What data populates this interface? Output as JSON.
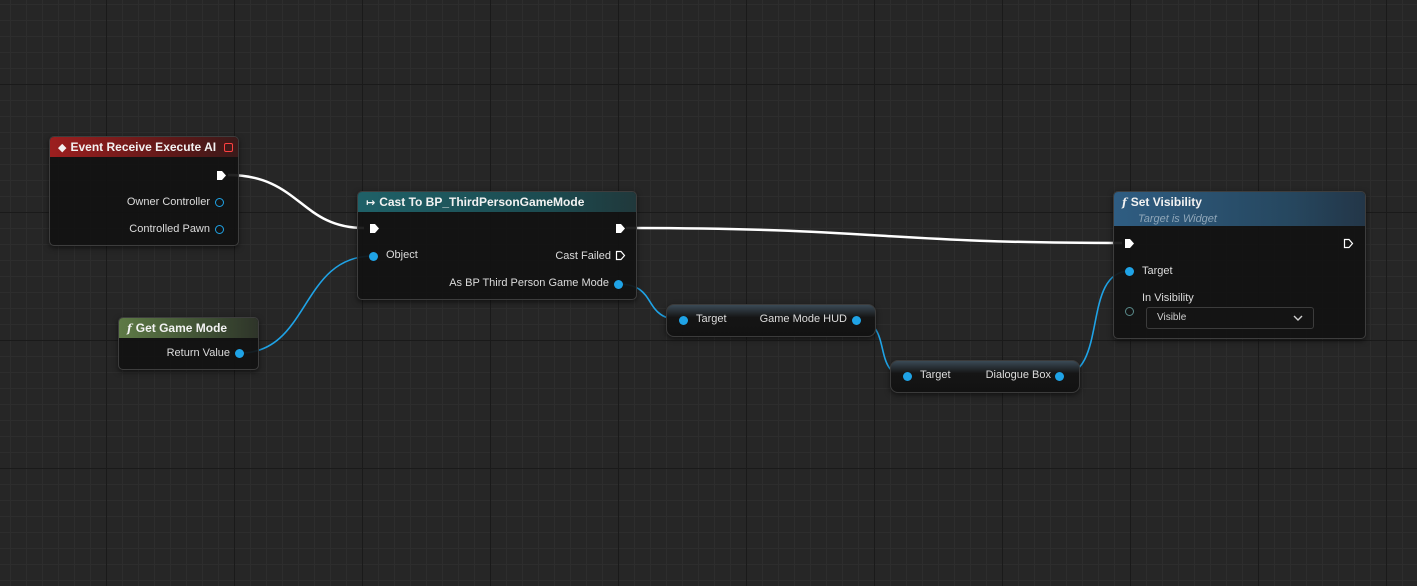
{
  "nodes": {
    "event": {
      "title": "Event Receive Execute AI",
      "pins": {
        "owner_controller": "Owner Controller",
        "controlled_pawn": "Controlled Pawn"
      }
    },
    "get_game_mode": {
      "title": "Get Game Mode",
      "pins": {
        "return_value": "Return Value"
      }
    },
    "cast": {
      "title": "Cast To BP_ThirdPersonGameMode",
      "pins": {
        "object": "Object",
        "cast_failed": "Cast Failed",
        "as_bp": "As BP Third Person Game Mode"
      }
    },
    "get_hud": {
      "pins": {
        "target": "Target",
        "output": "Game Mode HUD"
      }
    },
    "get_dialogue": {
      "pins": {
        "target": "Target",
        "output": "Dialogue Box"
      }
    },
    "set_visibility": {
      "title": "Set Visibility",
      "subtitle": "Target is Widget",
      "pins": {
        "target": "Target",
        "in_visibility": "In Visibility"
      },
      "visibility_value": "Visible"
    }
  },
  "icons": {
    "event": "diamond-event-icon",
    "function": "function-f-icon",
    "cast": "cast-arrows-icon",
    "dropdown": "chevron-down-icon"
  },
  "colors": {
    "background": "#262626",
    "object_pin": "#1fa3e6",
    "exec_wire": "#ffffff",
    "event_header": "#9c1f1f",
    "pure_header": "#5e7a46",
    "cast_header": "#1f6168",
    "function_header": "#2f5d82"
  }
}
